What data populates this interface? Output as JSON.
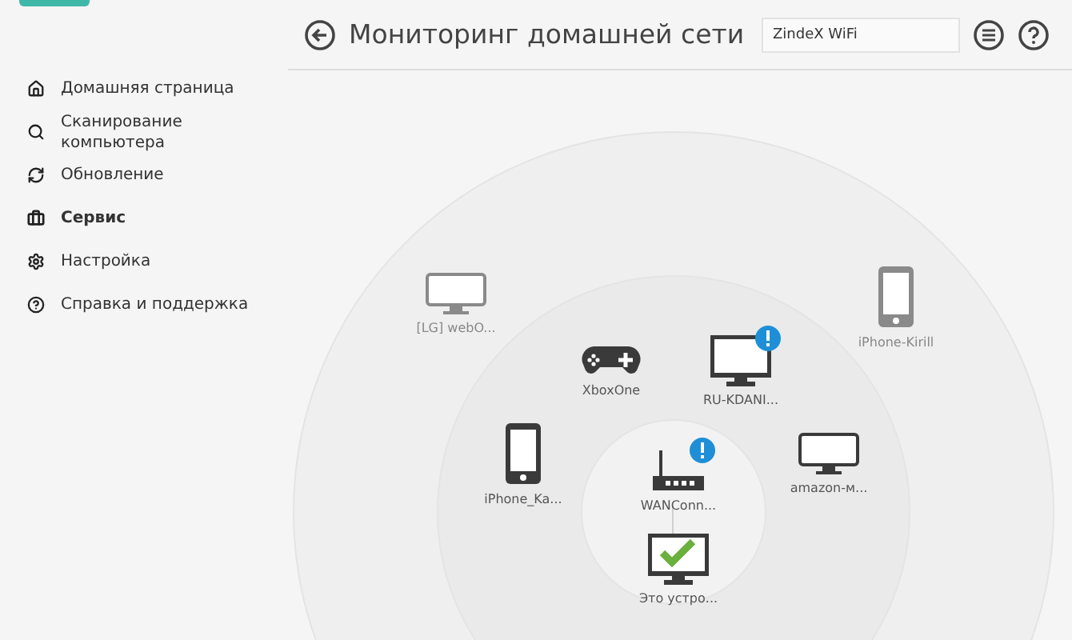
{
  "sidebar": {
    "items": [
      {
        "label": "Домашняя страница",
        "selected": false
      },
      {
        "label": "Сканирование компьютера",
        "selected": false
      },
      {
        "label": "Обновление",
        "selected": false
      },
      {
        "label": "Сервис",
        "selected": true
      },
      {
        "label": "Настройка",
        "selected": false
      },
      {
        "label": "Справка и поддержка",
        "selected": false
      }
    ]
  },
  "header": {
    "title": "Мониторинг домашней сети",
    "network_field": "ZindeX WiFi"
  },
  "devices": [
    {
      "label": "[LG] webO...",
      "kind": "tv",
      "online": false,
      "alert": false
    },
    {
      "label": "iPhone-Kirill",
      "kind": "phone",
      "online": false,
      "alert": false
    },
    {
      "label": "XboxOne",
      "kind": "gamepad",
      "online": true,
      "alert": false
    },
    {
      "label": "RU-KDANI...",
      "kind": "monitor",
      "online": true,
      "alert": true
    },
    {
      "label": "iPhone_Ka...",
      "kind": "phone",
      "online": true,
      "alert": false
    },
    {
      "label": "amazon-м...",
      "kind": "tv",
      "online": true,
      "alert": false
    },
    {
      "label": "WANConn...",
      "kind": "router",
      "online": true,
      "alert": true
    },
    {
      "label": "Это устро...",
      "kind": "this-device",
      "online": true,
      "alert": false
    }
  ]
}
